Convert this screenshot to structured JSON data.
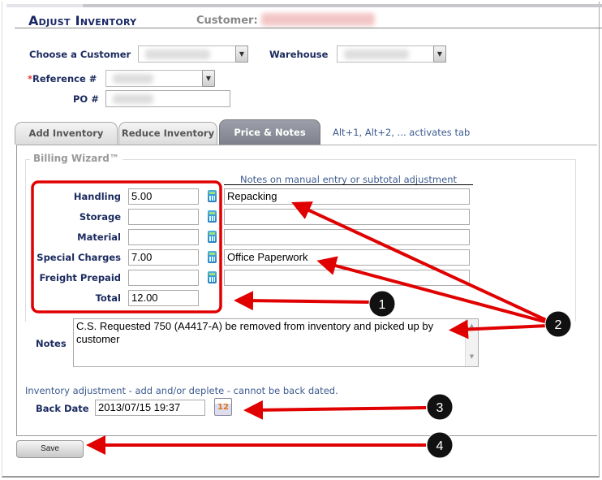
{
  "header": {
    "title": "Adjust Inventory",
    "customer_label": "Customer:"
  },
  "form": {
    "choose_customer_label": "Choose a Customer",
    "warehouse_label": "Warehouse",
    "reference_required": "*",
    "reference_label": "Reference #",
    "po_label": "PO #"
  },
  "tabs": [
    {
      "label": "Add Inventory"
    },
    {
      "label": "Reduce Inventory"
    },
    {
      "label": "Price & Notes",
      "active": true
    }
  ],
  "tab_hint": "Alt+1, Alt+2, ... activates tab",
  "billing": {
    "legend": "Billing Wizard™",
    "notes_header": "Notes on manual entry or subtotal adjustment",
    "rows": [
      {
        "label": "Handling",
        "value": "5.00",
        "note": "Repacking"
      },
      {
        "label": "Storage",
        "value": "",
        "note": ""
      },
      {
        "label": "Material",
        "value": "",
        "note": ""
      },
      {
        "label": "Special Charges",
        "value": "7.00",
        "note": "Office Paperwork"
      },
      {
        "label": "Freight Prepaid",
        "value": "",
        "note": ""
      }
    ],
    "total_label": "Total",
    "total_value": "12.00"
  },
  "notes": {
    "label": "Notes",
    "value": "C.S. Requested  750 (A4417-A) be removed from inventory and picked up by customer"
  },
  "info_text": "Inventory adjustment - add and/or deplete - cannot be back dated.",
  "back_date": {
    "label": "Back Date",
    "value": "2013/07/15 19:37",
    "calendar_day": "12"
  },
  "save_label": "Save",
  "callouts": [
    "1",
    "2",
    "3",
    "4"
  ],
  "colors": {
    "annotation": "#e00000",
    "label": "#1a2a5e",
    "active_tab": "#8a8e9a"
  }
}
